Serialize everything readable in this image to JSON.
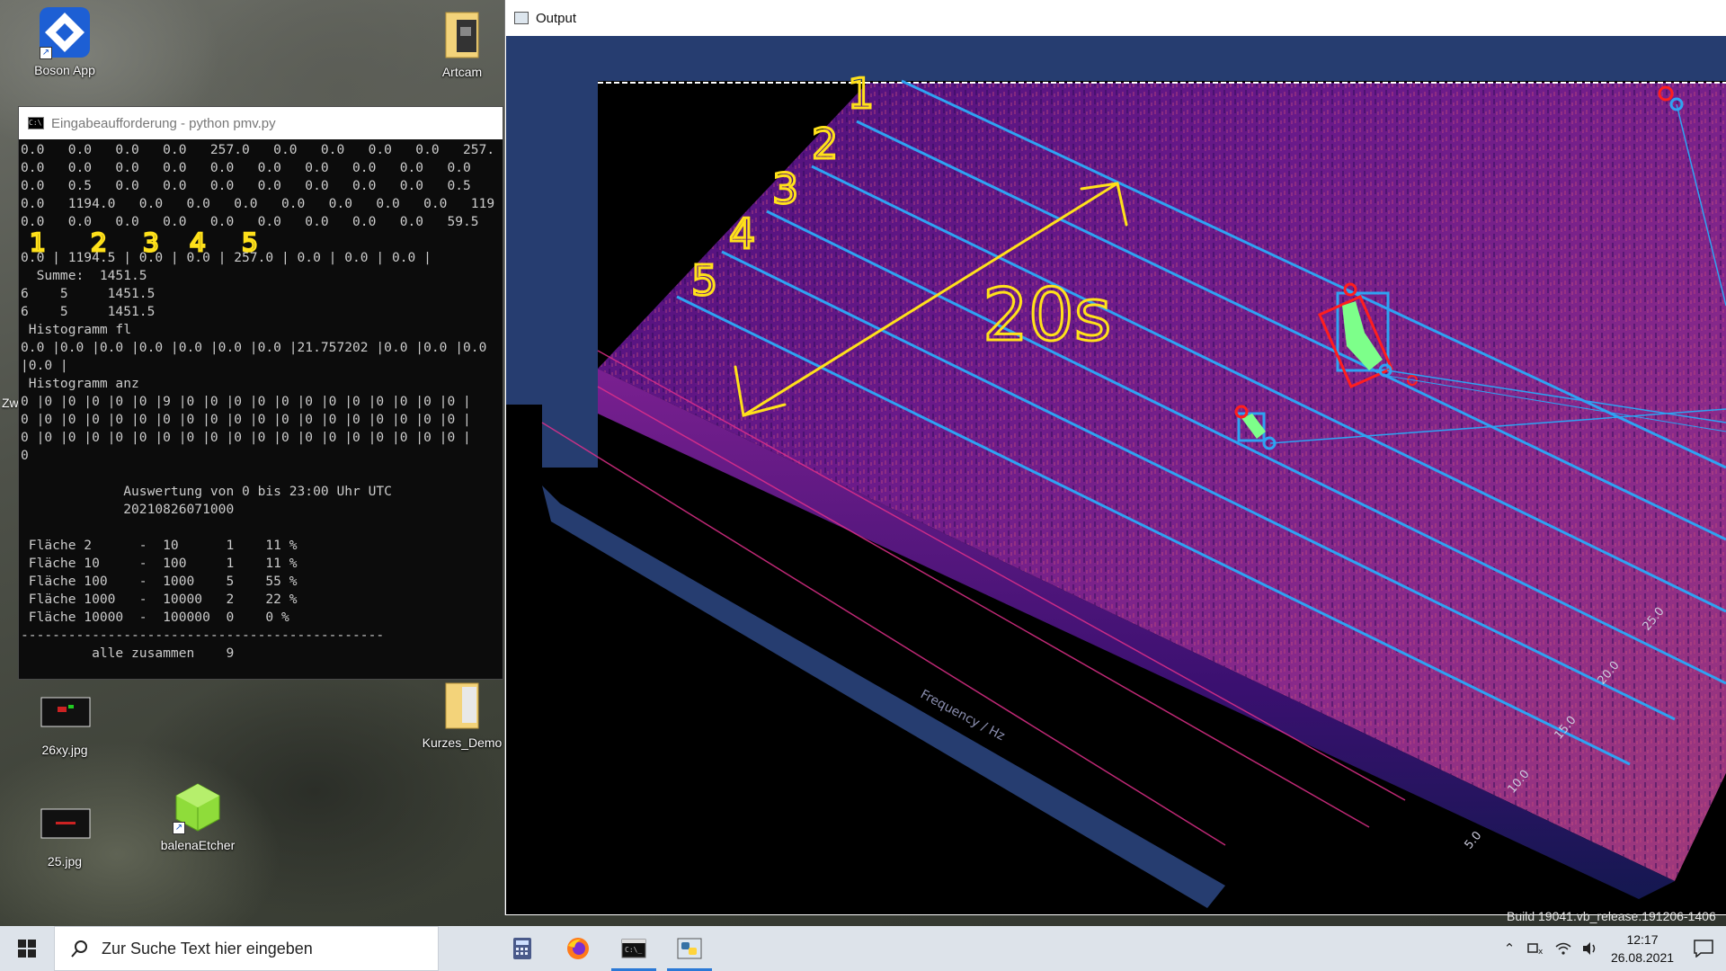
{
  "desktop": {
    "icons": [
      {
        "label": "Boson App",
        "icon": "boson-app-icon"
      },
      {
        "label": "Artcam",
        "icon": "folder-icon"
      },
      {
        "label": "26xy.jpg",
        "icon": "image-file-icon"
      },
      {
        "label": "Kurzes_Demo",
        "icon": "folder-icon"
      },
      {
        "label": "25.jpg",
        "icon": "image-file-icon"
      },
      {
        "label": "balenaEtcher",
        "icon": "balena-cube-icon"
      }
    ],
    "edge_label": "Zw"
  },
  "console": {
    "title": "Eingabeaufforderung - python  pmv.py",
    "lines": [
      "0.0   0.0   0.0   0.0   257.0   0.0   0.0   0.0   0.0   257.",
      "0.0   0.0   0.0   0.0   0.0   0.0   0.0   0.0   0.0   0.0",
      "0.0   0.5   0.0   0.0   0.0   0.0   0.0   0.0   0.0   0.5",
      "0.0   1194.0   0.0   0.0   0.0   0.0   0.0   0.0   0.0   119",
      "0.0   0.0   0.0   0.0   0.0   0.0   0.0   0.0   0.0   59.5",
      "",
      "0.0 | 1194.5 | 0.0 | 0.0 | 257.0 | 0.0 | 0.0 | 0.0 |",
      "  Summe:  1451.5",
      "6    5     1451.5",
      "6    5     1451.5",
      " Histogramm fl",
      "0.0 |0.0 |0.0 |0.0 |0.0 |0.0 |0.0 |21.757202 |0.0 |0.0 |0.0",
      "|0.0 |",
      " Histogramm anz",
      "0 |0 |0 |0 |0 |0 |9 |0 |0 |0 |0 |0 |0 |0 |0 |0 |0 |0 |0 |",
      "0 |0 |0 |0 |0 |0 |0 |0 |0 |0 |0 |0 |0 |0 |0 |0 |0 |0 |0 |",
      "0 |0 |0 |0 |0 |0 |0 |0 |0 |0 |0 |0 |0 |0 |0 |0 |0 |0 |0 |",
      "0",
      "",
      "             Auswertung von 0 bis 23:00 Uhr UTC",
      "             20210826071000",
      "",
      " Fläche 2      -  10      1    11 %",
      " Fläche 10     -  100     1    11 %",
      " Fläche 100    -  1000    5    55 %",
      " Fläche 1000   -  10000   2    22 %",
      " Fläche 10000  -  100000  0    0 %",
      "----------------------------------------------",
      "         alle zusammen    9"
    ],
    "handwritten_numbers": [
      "1",
      "2",
      "3",
      "4",
      "5"
    ]
  },
  "output": {
    "title": "Output",
    "axis_label": "Frequency / Hz",
    "tick_labels": [
      "5.0",
      "10.0",
      "15.0",
      "20.0",
      "25.0"
    ],
    "annotation_text": "20s",
    "row_numbers": [
      "1",
      "2",
      "3",
      "4",
      "5"
    ],
    "colors": {
      "spectrum_dark": "#3b0b6e",
      "spectrum_mid": "#7a1f8f",
      "spectrum_hot": "#c8408a",
      "grid_line": "#2ea3f2",
      "highlight": "#7dff8a",
      "marker": "#ff1e1e",
      "frame": "#263d70"
    }
  },
  "build": "Build 19041.vb_release.191206-1406",
  "taskbar": {
    "search_placeholder": "Zur Suche Text hier eingeben",
    "apps": [
      {
        "name": "calculator-icon",
        "active": false
      },
      {
        "name": "firefox-icon",
        "active": false
      },
      {
        "name": "terminal-icon",
        "active": true
      },
      {
        "name": "python-icon",
        "active": true
      }
    ],
    "clock_time": "12:17",
    "clock_date": "26.08.2021"
  }
}
